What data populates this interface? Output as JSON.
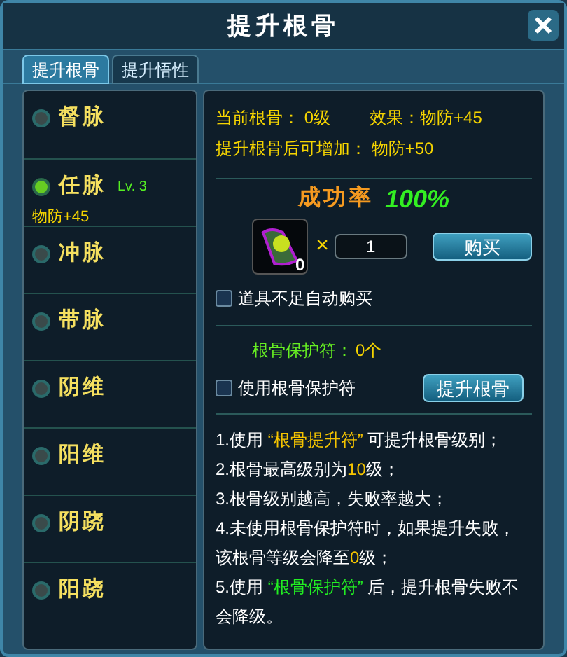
{
  "window": {
    "title": "提升根骨"
  },
  "tabs": [
    {
      "label": "提升根骨",
      "selected": true
    },
    {
      "label": "提升悟性",
      "selected": false
    }
  ],
  "meridians": [
    {
      "name": "督脉",
      "active": false
    },
    {
      "name": "任脉",
      "active": true,
      "level_text": "Lv. 3",
      "bonus": "物防+45"
    },
    {
      "name": "冲脉",
      "active": false
    },
    {
      "name": "带脉",
      "active": false
    },
    {
      "name": "阴维",
      "active": false
    },
    {
      "name": "阳维",
      "active": false
    },
    {
      "name": "阴跷",
      "active": false
    },
    {
      "name": "阳跷",
      "active": false
    }
  ],
  "status": {
    "current_label": "当前根骨：",
    "current_value": "0级",
    "effect_label": "效果：物防+45",
    "increase_label": "提升根骨后可增加：",
    "increase_value": "物防+50"
  },
  "success": {
    "label": "成功率",
    "value": "100%"
  },
  "item": {
    "count": "0",
    "times": "×",
    "quantity": "1",
    "buy_button": "购买"
  },
  "auto_buy": {
    "label": "道具不足自动购买",
    "checked": false
  },
  "protect": {
    "label": "根骨保护符：",
    "count": "0个"
  },
  "use_protect": {
    "label": "使用根骨保护符",
    "checked": false
  },
  "upgrade_button": "提升根骨",
  "notes": [
    [
      {
        "text": "1.使用 "
      },
      {
        "text": "“根骨提升符”",
        "color": "#f5c400"
      },
      {
        "text": " 可提升根骨级别；"
      }
    ],
    [
      {
        "text": "2.根骨最高级别为"
      },
      {
        "text": "10",
        "color": "#f5c400"
      },
      {
        "text": "级；"
      }
    ],
    [
      {
        "text": "3.根骨级别越高，失败率越大；"
      }
    ],
    [
      {
        "text": "4.未使用根骨保护符时，如果提升失败，该根骨等级会降至"
      },
      {
        "text": "0",
        "color": "#f5c400"
      },
      {
        "text": "级；"
      }
    ],
    [
      {
        "text": "5.使用 "
      },
      {
        "text": "“根骨保护符”",
        "color": "#22ee22"
      },
      {
        "text": " 后，提升根骨失败不会降级。"
      }
    ]
  ]
}
